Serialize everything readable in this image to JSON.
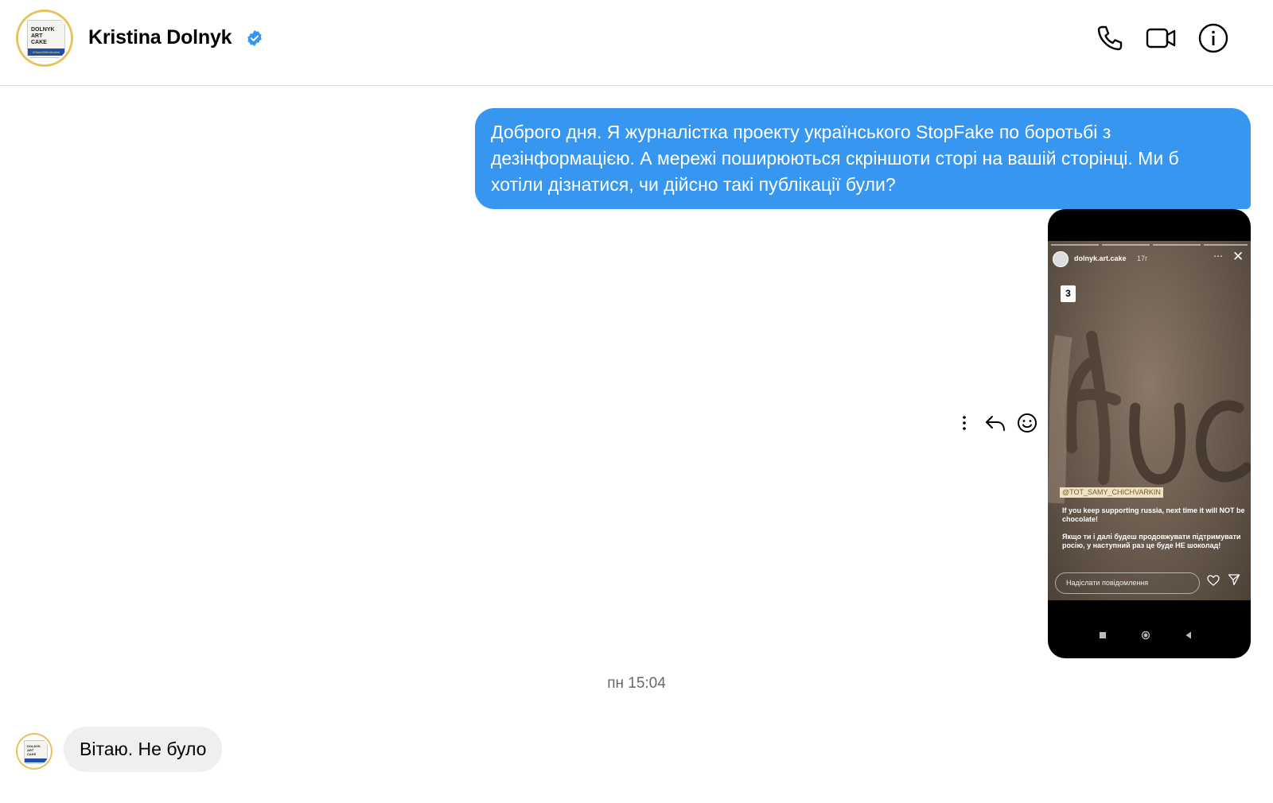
{
  "header": {
    "contact_name": "Kristina Dolnyk",
    "verified": true,
    "avatar_text": "DOLNYK\nART\nCAKE",
    "avatar_tag": "#StandWithUkraine",
    "icons": [
      "phone-icon",
      "video-call-icon",
      "info-icon"
    ]
  },
  "messages": {
    "outgoing_text": "Доброго дня. Я журналістка проекту українського StopFake по боротьбі з дезінформацією. А мережі поширюються скріншоти сторі на вашій сторінці. Ми б хотіли дізнатися, чи дійсно такі публікації були?",
    "timestamp": "пн 15:04",
    "incoming_text": "Вітаю. Не було"
  },
  "story_screenshot": {
    "username": "dolnyk.art.cake",
    "time_ago": "17г",
    "number_badge": "3",
    "mention": "@TOT_SAMY_CHICHVARKIN",
    "caption": "If you keep supporting russia, next time it will NOT be chocolate!\n\nЯкщо ти і далі будеш продовжувати підтримувати росію, у наступний раз це буде НЕ шоколад!",
    "reply_placeholder": "Надіслати повідомлення"
  },
  "message_actions": [
    "more-options-icon",
    "reply-icon",
    "emoji-reaction-icon"
  ],
  "colors": {
    "outgoing_bubble": "#3797f0",
    "incoming_bubble": "#efefef",
    "verified_badge": "#3797f0",
    "avatar_ring": "#e8c25a"
  }
}
